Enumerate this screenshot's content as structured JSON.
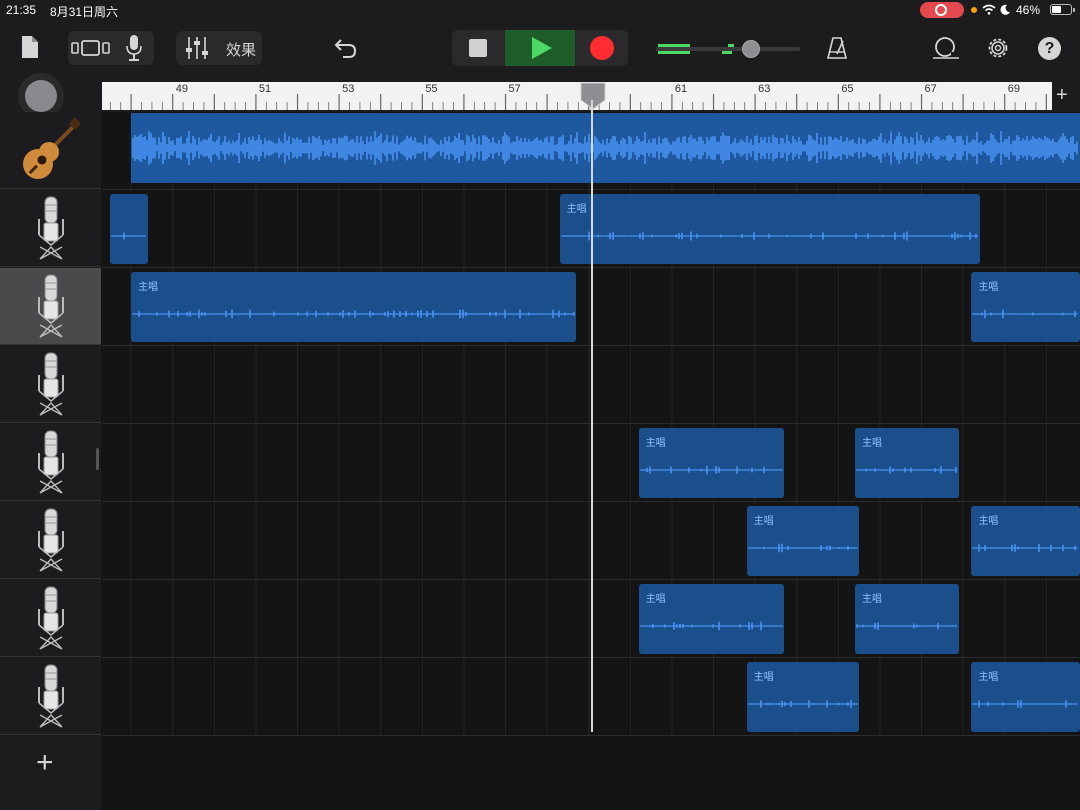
{
  "status_bar": {
    "time": "21:35",
    "date": "8月31日周六",
    "battery": "46%",
    "wifi_icon": "wifi-icon",
    "moon_icon": "moon-icon"
  },
  "toolbar": {
    "effects_label": "效果",
    "icons": {
      "browser": "document-icon",
      "view": "tracks-view-icon",
      "instrument": "microphone-icon",
      "mixer": "sliders-icon",
      "undo": "undo-icon",
      "metronome": "metronome-icon",
      "loop": "loop-icon",
      "settings": "gear-icon",
      "help": "?"
    },
    "colors": {
      "play": "#4cd964",
      "record": "#ff2d30",
      "region": "#1a4f8c",
      "wave": "#4e9bff"
    }
  },
  "ruler": {
    "bars": [
      "49",
      "51",
      "53",
      "55",
      "57",
      "59",
      "61",
      "63",
      "65",
      "67",
      "69"
    ],
    "add_label": "+"
  },
  "tracks": [
    {
      "instrument": "acoustic-guitar-icon",
      "regions": [
        {
          "label": "",
          "start_bar": 48.0,
          "end_bar": 71.5,
          "full": true
        }
      ]
    },
    {
      "instrument": "microphone-icon",
      "regions": [
        {
          "label": "",
          "start_bar": 47.5,
          "end_bar": 48.4
        },
        {
          "label": "主唱",
          "start_bar": 58.3,
          "end_bar": 68.4
        }
      ]
    },
    {
      "instrument": "microphone-icon",
      "selected": true,
      "regions": [
        {
          "label": "主唱",
          "start_bar": 48.0,
          "end_bar": 58.7
        },
        {
          "label": "主唱",
          "start_bar": 68.2,
          "end_bar": 71.5
        }
      ]
    },
    {
      "instrument": "microphone-icon",
      "regions": []
    },
    {
      "instrument": "microphone-icon",
      "regions": [
        {
          "label": "主唱",
          "start_bar": 60.2,
          "end_bar": 63.7
        },
        {
          "label": "主唱",
          "start_bar": 65.4,
          "end_bar": 67.9
        }
      ]
    },
    {
      "instrument": "microphone-icon",
      "regions": [
        {
          "label": "主唱",
          "start_bar": 62.8,
          "end_bar": 65.5
        },
        {
          "label": "主唱",
          "start_bar": 68.2,
          "end_bar": 71.5
        }
      ]
    },
    {
      "instrument": "microphone-icon",
      "regions": [
        {
          "label": "主唱",
          "start_bar": 60.2,
          "end_bar": 63.7
        },
        {
          "label": "主唱",
          "start_bar": 65.4,
          "end_bar": 67.9
        }
      ]
    },
    {
      "instrument": "microphone-icon",
      "regions": [
        {
          "label": "主唱",
          "start_bar": 62.8,
          "end_bar": 65.5
        },
        {
          "label": "主唱",
          "start_bar": 68.2,
          "end_bar": 71.5
        }
      ]
    }
  ],
  "playhead_bar": 59.3,
  "add_track_label": "+"
}
